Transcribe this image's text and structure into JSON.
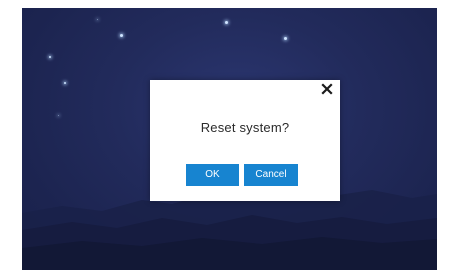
{
  "dialog": {
    "message": "Reset system?",
    "ok_label": "OK",
    "cancel_label": "Cancel",
    "close_icon": "close-icon"
  },
  "colors": {
    "background": "#1e2654",
    "button": "#1784d0",
    "dialog": "#ffffff"
  }
}
